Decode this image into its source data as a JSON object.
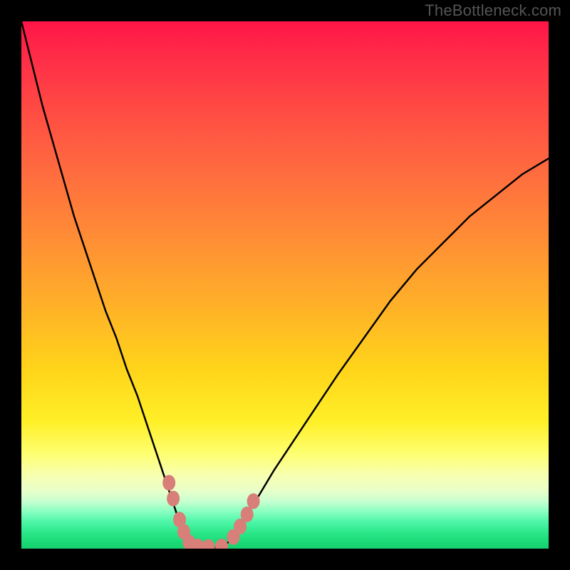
{
  "watermark": "TheBottleneck.com",
  "colors": {
    "marker": "#d77f78",
    "curve": "#000000",
    "gradient_top": "#ff1548",
    "gradient_bottom": "#16d070"
  },
  "chart_data": {
    "type": "line",
    "title": "",
    "xlabel": "",
    "ylabel": "",
    "xlim": [
      0,
      100
    ],
    "ylim": [
      0,
      100
    ],
    "note": "Values are estimated from pixel positions; x is horizontal percent across plot, y is bottleneck percent (0 at bottom/green, 100 at top/red).",
    "series": [
      {
        "name": "left_branch",
        "x": [
          0,
          2,
          4,
          6,
          8,
          10,
          12,
          14,
          16,
          18,
          20,
          22,
          24,
          26,
          28,
          29,
          30,
          31,
          32
        ],
        "y": [
          100,
          92,
          84,
          77,
          70,
          63,
          57,
          51,
          45,
          40,
          34,
          29,
          23,
          17,
          11,
          8,
          5,
          3,
          1
        ]
      },
      {
        "name": "flat_bottom",
        "x": [
          32,
          33,
          34,
          35,
          36,
          37,
          38,
          39
        ],
        "y": [
          0.5,
          0.3,
          0.2,
          0.2,
          0.2,
          0.2,
          0.3,
          0.5
        ]
      },
      {
        "name": "right_branch",
        "x": [
          39,
          40,
          42,
          45,
          48,
          52,
          56,
          60,
          65,
          70,
          75,
          80,
          85,
          90,
          95,
          100
        ],
        "y": [
          1,
          2,
          5,
          10,
          15,
          21,
          27,
          33,
          40,
          47,
          53,
          58,
          63,
          67,
          71,
          74
        ]
      }
    ],
    "markers": [
      {
        "name": "m1",
        "x": 28.0,
        "y": 12.5
      },
      {
        "name": "m2",
        "x": 28.8,
        "y": 9.5
      },
      {
        "name": "m3",
        "x": 30.0,
        "y": 5.5
      },
      {
        "name": "m4",
        "x": 30.8,
        "y": 3.2
      },
      {
        "name": "m5",
        "x": 31.8,
        "y": 1.2
      },
      {
        "name": "m6",
        "x": 33.5,
        "y": 0.4
      },
      {
        "name": "m7",
        "x": 35.5,
        "y": 0.3
      },
      {
        "name": "m8",
        "x": 38.0,
        "y": 0.4
      },
      {
        "name": "m9",
        "x": 40.2,
        "y": 2.2
      },
      {
        "name": "m10",
        "x": 41.5,
        "y": 4.2
      },
      {
        "name": "m11",
        "x": 42.8,
        "y": 6.5
      },
      {
        "name": "m12",
        "x": 44.0,
        "y": 9.0
      }
    ]
  }
}
